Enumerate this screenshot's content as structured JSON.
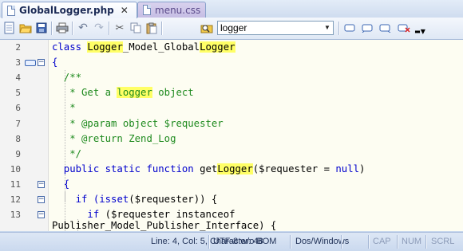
{
  "tabs": [
    {
      "label": "GlobalLogger.php",
      "close": "✕",
      "active": true
    },
    {
      "label": "menu.css",
      "active": false
    }
  ],
  "toolbar": {
    "search_value": "logger",
    "icons": [
      "new-file-icon",
      "open-folder-icon",
      "save-icon",
      "print-icon",
      "undo-icon",
      "redo-icon",
      "cut-icon",
      "copy-icon",
      "paste-icon",
      "find-icon",
      "toggle-bookmark-icon",
      "prev-bookmark-icon",
      "next-bookmark-icon",
      "clear-bookmarks-icon",
      "toolbar-overflow-icon"
    ]
  },
  "editor": {
    "lines": [
      {
        "n": "2",
        "segs": [
          {
            "t": "class ",
            "c": "kw"
          },
          {
            "t": "Logger",
            "c": "hl"
          },
          {
            "t": "_Model_Global"
          },
          {
            "t": "Logger",
            "c": "hl"
          }
        ]
      },
      {
        "n": "3",
        "segs": [
          {
            "t": "{",
            "c": "kw"
          }
        ]
      },
      {
        "n": "4",
        "segs": [
          {
            "t": "  /**",
            "c": "cm"
          }
        ]
      },
      {
        "n": "5",
        "segs": [
          {
            "t": "   * Get a ",
            "c": "cm"
          },
          {
            "t": "logger",
            "c": "hl cm"
          },
          {
            "t": " object",
            "c": "cm"
          }
        ]
      },
      {
        "n": "6",
        "segs": [
          {
            "t": "   *",
            "c": "cm"
          }
        ]
      },
      {
        "n": "7",
        "segs": [
          {
            "t": "   * @param object $requester",
            "c": "cm"
          }
        ]
      },
      {
        "n": "8",
        "segs": [
          {
            "t": "   * @return Zend_Log",
            "c": "cm"
          }
        ]
      },
      {
        "n": "9",
        "segs": [
          {
            "t": "   */",
            "c": "cm"
          }
        ]
      },
      {
        "n": "10",
        "segs": [
          {
            "t": "  public static function ",
            "c": "kw"
          },
          {
            "t": "get"
          },
          {
            "t": "Logger",
            "c": "hl"
          },
          {
            "t": "("
          },
          {
            "t": "$requester = ",
            "c": ""
          },
          {
            "t": "null",
            "c": "kw"
          },
          {
            "t": ")"
          }
        ]
      },
      {
        "n": "11",
        "segs": [
          {
            "t": "  {",
            "c": "kw"
          }
        ]
      },
      {
        "n": "12",
        "segs": [
          {
            "t": "    if ",
            "c": "kw"
          },
          {
            "t": "(",
            "c": "kw"
          },
          {
            "t": "isset",
            "c": "kw"
          },
          {
            "t": "($requester)) {",
            "c": ""
          }
        ]
      },
      {
        "n": "13",
        "segs": [
          {
            "t": "      if ",
            "c": "kw"
          },
          {
            "t": "($requester instanceof",
            "c": ""
          }
        ]
      },
      {
        "n": "",
        "segs": [
          {
            "t": "Publisher_Model_Publisher_Interface) {",
            "c": ""
          }
        ]
      }
    ]
  },
  "status": {
    "position": "Line: 4, Col: 5, Character: 48",
    "encoding": "UTF-8 w/o BOM",
    "line_endings": "Dos/Windows",
    "cap": "CAP",
    "num": "NUM",
    "scrl": "SCRL"
  }
}
